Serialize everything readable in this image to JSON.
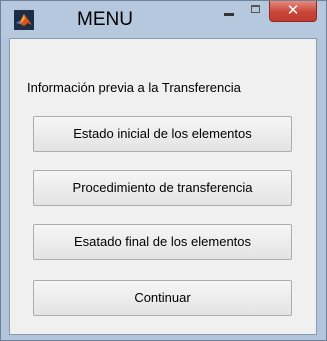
{
  "window": {
    "title": "MENU",
    "icon": "matlab-logo-icon",
    "controls": {
      "minimize_icon": "minimize-icon",
      "maximize_icon": "maximize-icon",
      "close_label": "✕"
    },
    "accent_colors": {
      "title_bar": "#b6c8de",
      "close_button": "#c9463a",
      "client_background": "#f0f0f0"
    }
  },
  "content": {
    "info_text": "Información previa a la Transferencia",
    "buttons": [
      {
        "label": "Estado inicial de los elementos"
      },
      {
        "label": "Procedimiento de transferencia"
      },
      {
        "label": "Esatado final de los elementos"
      },
      {
        "label": "Continuar"
      }
    ]
  }
}
